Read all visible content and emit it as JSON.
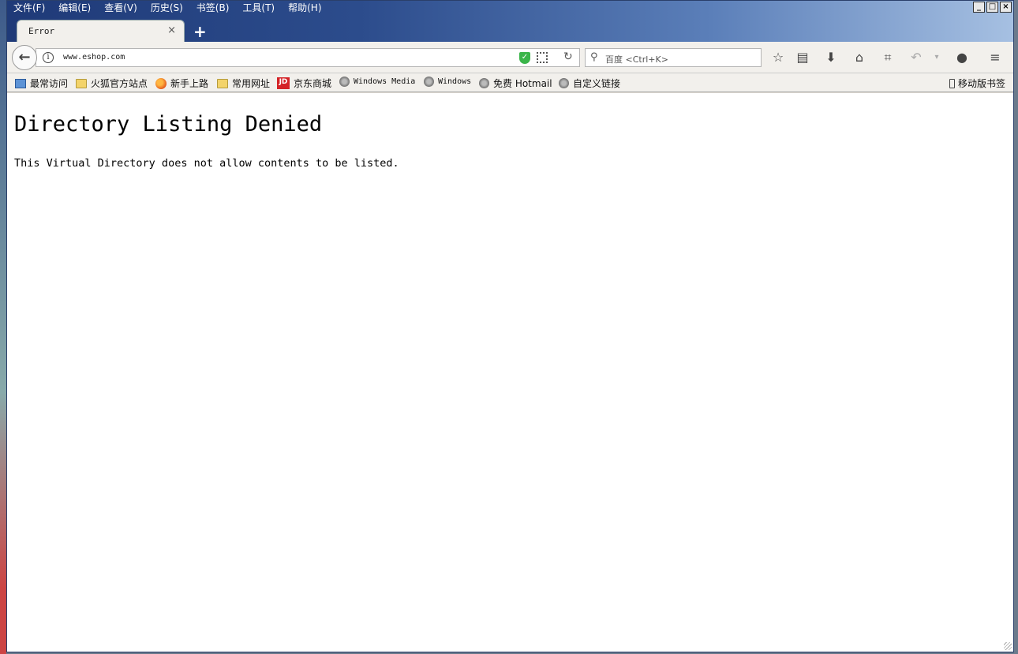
{
  "menubar": [
    "文件(F)",
    "编辑(E)",
    "查看(V)",
    "历史(S)",
    "书签(B)",
    "工具(T)",
    "帮助(H)"
  ],
  "window_buttons": {
    "minimize": "_",
    "maximize": "□",
    "close": "×"
  },
  "tab": {
    "title": "Error",
    "close": "×"
  },
  "new_tab": "+",
  "navbar": {
    "url": "www.eshop.com",
    "info": "i",
    "search_placeholder": "百度 <Ctrl+K>"
  },
  "bookmarks": [
    {
      "label": "最常访问",
      "icon": "recent-icon"
    },
    {
      "label": "火狐官方站点",
      "icon": "folder-icon"
    },
    {
      "label": "新手上路",
      "icon": "firefox-icon"
    },
    {
      "label": "常用网址",
      "icon": "folder-icon"
    },
    {
      "label": "京东商城",
      "icon": "jd-icon",
      "badge": "JD"
    },
    {
      "label": "Windows Media",
      "icon": "globe-icon"
    },
    {
      "label": "Windows",
      "icon": "globe-icon"
    },
    {
      "label": "免费 Hotmail",
      "icon": "globe-icon"
    },
    {
      "label": "自定义链接",
      "icon": "globe-icon"
    }
  ],
  "mobile_bookmarks": "移动版书签",
  "page": {
    "heading": "Directory Listing Denied",
    "message": "This Virtual Directory does not allow contents to be listed."
  }
}
